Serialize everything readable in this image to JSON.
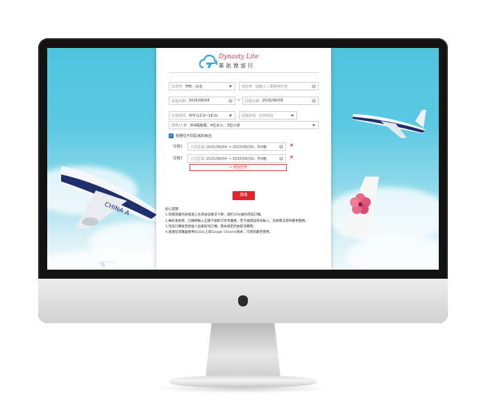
{
  "brand": {
    "name_en": "Dynasty Lite",
    "name_zh": "華航微旅行"
  },
  "form": {
    "origin": {
      "label": "出發地",
      "value": "TPE - 台北"
    },
    "destination": {
      "label": "目的地",
      "placeholder": "請輸入 / 選擇目的地"
    },
    "depart_date": {
      "label": "去程日期",
      "value": "2015/06/04"
    },
    "return_date": {
      "label": "回程日期",
      "value": "2015/06/09"
    },
    "depart_time": {
      "label": "出發時段",
      "value": "中午(12:0~16:0)"
    },
    "return_time": {
      "label": "回程時段",
      "placeholder": "任何時段"
    },
    "rooms_guests": {
      "label": "間數/人數",
      "value": "共4間房間、4位大人、3位小孩"
    },
    "multi_hotel_checkbox": {
      "label": "我要住不同區域的飯店",
      "checked": true
    },
    "stays": [
      {
        "label": "住宿1",
        "placeholder": "入住區間",
        "value": "2015/06/04 ～ 2015/06/09，共4晚"
      },
      {
        "label": "住宿2",
        "placeholder": "入住區間",
        "value": "2015/06/04 ～ 2015/06/09，共4晚"
      }
    ],
    "add_stay_label": "+ 增加住宿",
    "search_label": "搜尋"
  },
  "notes": {
    "title": "貼心提醒:",
    "items": [
      "1.為搶高優先保留過入住或食宿無法下單，請於20分鐘內完成訂購。",
      "2.華航會員者，訂購時輸入正確卡號即可享有優惠，若卡號錯誤或未輸入，您將無法提供變更服務。",
      "3.完成訂購後若因個人因素取消訂購，需依規定酌收取消費用。",
      "4.建議您瀏覽器使用IE10以上或Google Chrome版本，可達到最佳使用。"
    ]
  },
  "colors": {
    "accent_red": "#e1262b",
    "brand_blue": "#35a9d3",
    "sky": "#5bc9e2"
  }
}
